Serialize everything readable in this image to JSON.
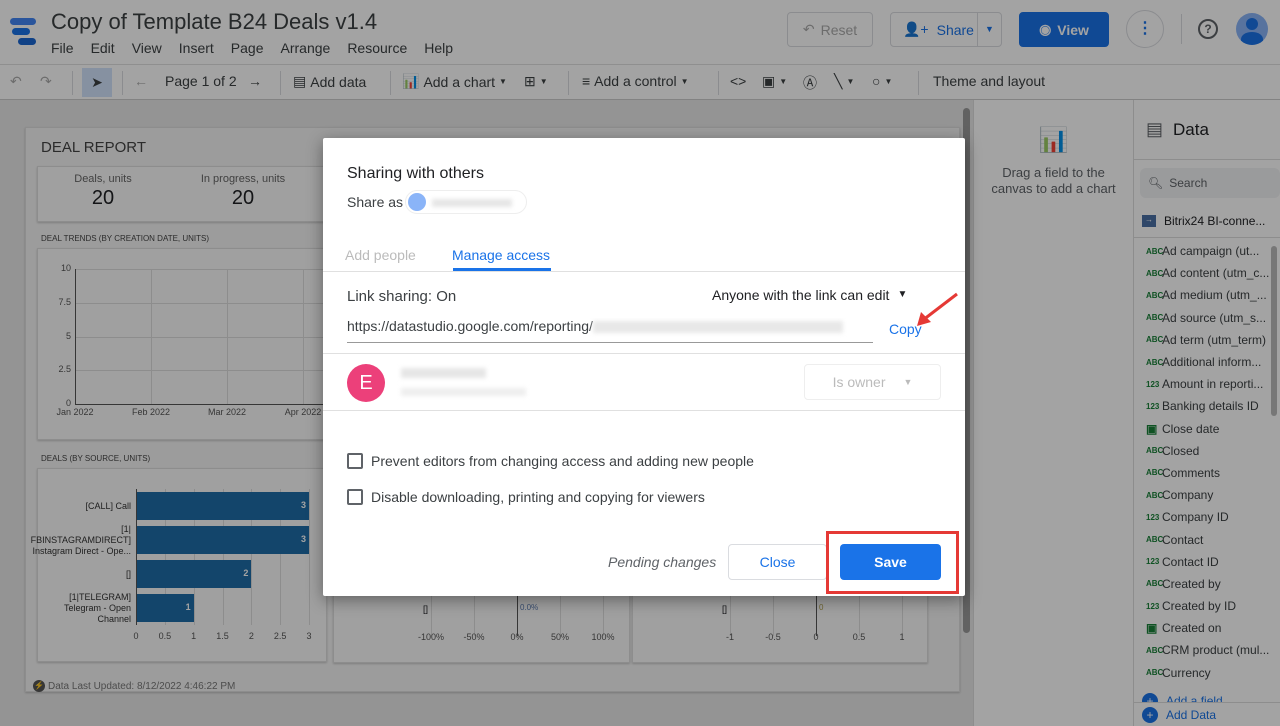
{
  "app": {
    "title": "Copy of Template B24 Deals v1.4",
    "menu": [
      "File",
      "Edit",
      "View",
      "Insert",
      "Page",
      "Arrange",
      "Resource",
      "Help"
    ],
    "reset_label": "Reset",
    "share_label": "Share",
    "view_label": "View",
    "accent": "#1a73e8"
  },
  "toolbar": {
    "page_label": "Page 1 of 2",
    "add_data": "Add data",
    "add_chart": "Add a chart",
    "add_control": "Add a control",
    "theme": "Theme and layout"
  },
  "report": {
    "title": "DEAL REPORT",
    "kpis": [
      {
        "label": "Deals, units",
        "value": "20"
      },
      {
        "label": "In progress, units",
        "value": "20"
      }
    ],
    "footer": "Data Last Updated: 8/12/2022 4:46:22 PM"
  },
  "chart_data": [
    {
      "type": "line",
      "title": "DEAL TRENDS (BY CREATION DATE, UNITS)",
      "x_ticks": [
        "Jan 2022",
        "Feb 2022",
        "Mar 2022",
        "Apr 2022"
      ],
      "y_ticks": [
        "0",
        "2.5",
        "5",
        "7.5",
        "10"
      ],
      "ylim": [
        0,
        10
      ],
      "grid": true
    },
    {
      "type": "bar",
      "orientation": "horizontal",
      "title": "DEALS (BY SOURCE, UNITS)",
      "categories": [
        "[CALL] Call",
        "[1|FBINSTAGRAMDIRECT] Instagram Direct - Ope...",
        "[]",
        "[1|TELEGRAM] Telegram - Open Channel"
      ],
      "category_lines": [
        [
          "[CALL] Call"
        ],
        [
          "[1|",
          "FBINSTAGRAMDIRECT]",
          "Instagram Direct - Ope..."
        ],
        [
          "[]"
        ],
        [
          "[1|TELEGRAM]",
          "Telegram - Open",
          "Channel"
        ]
      ],
      "values": [
        3,
        3,
        2,
        1
      ],
      "x_ticks": [
        "0",
        "0.5",
        "1",
        "1.5",
        "2",
        "2.5",
        "3"
      ],
      "xlim": [
        0,
        3
      ],
      "color": "#1f6ca8"
    },
    {
      "type": "bar",
      "orientation": "horizontal",
      "categories": [
        "[]"
      ],
      "values": [
        0
      ],
      "data_label": "0.0%",
      "x_ticks": [
        "-100%",
        "-50%",
        "0%",
        "50%",
        "100%"
      ]
    },
    {
      "type": "bar",
      "orientation": "horizontal",
      "categories": [
        "[]"
      ],
      "values": [
        0
      ],
      "data_label": "0",
      "x_ticks": [
        "-1",
        "-0.5",
        "0",
        "0.5",
        "1"
      ]
    }
  ],
  "props": {
    "hint": "Drag a field to the canvas to add a chart"
  },
  "data_panel": {
    "title": "Data",
    "search_placeholder": "Search",
    "source": "Bitrix24 BI-conne...",
    "fields": [
      {
        "t": "ABC",
        "n": "Ad campaign (ut..."
      },
      {
        "t": "ABC",
        "n": "Ad content (utm_c..."
      },
      {
        "t": "ABC",
        "n": "Ad medium (utm_..."
      },
      {
        "t": "ABC",
        "n": "Ad source (utm_s..."
      },
      {
        "t": "ABC",
        "n": "Ad term (utm_term)"
      },
      {
        "t": "ABC",
        "n": "Additional inform..."
      },
      {
        "t": "123",
        "n": "Amount in reporti..."
      },
      {
        "t": "123",
        "n": "Banking details ID"
      },
      {
        "t": "date",
        "n": "Close date"
      },
      {
        "t": "ABC",
        "n": "Closed"
      },
      {
        "t": "ABC",
        "n": "Comments"
      },
      {
        "t": "ABC",
        "n": "Company"
      },
      {
        "t": "123",
        "n": "Company ID"
      },
      {
        "t": "ABC",
        "n": "Contact"
      },
      {
        "t": "123",
        "n": "Contact ID"
      },
      {
        "t": "ABC",
        "n": "Created by"
      },
      {
        "t": "123",
        "n": "Created by ID"
      },
      {
        "t": "date",
        "n": "Created on"
      },
      {
        "t": "ABC",
        "n": "CRM product (mul..."
      },
      {
        "t": "ABC",
        "n": "Currency"
      }
    ],
    "add_field": "Add a field",
    "add_data": "Add Data"
  },
  "dialog": {
    "title": "Sharing with others",
    "share_as": "Share as",
    "tabs": [
      "Add people",
      "Manage access"
    ],
    "active_tab": 1,
    "link_sharing": "Link sharing: On",
    "link_permission": "Anyone with the link can edit",
    "url_prefix": "https://datastudio.google.com/reporting/",
    "copy": "Copy",
    "owner_initial": "E",
    "owner_role": "Is owner",
    "options": [
      "Prevent editors from changing access and adding new people",
      "Disable downloading, printing and copying for viewers"
    ],
    "pending": "Pending changes",
    "close": "Close",
    "save": "Save",
    "highlight": "#e53935"
  }
}
